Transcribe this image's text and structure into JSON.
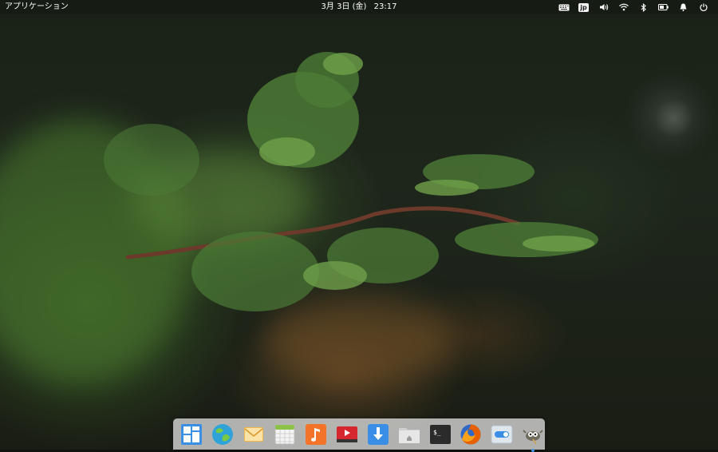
{
  "top_panel": {
    "applications_label": "アプリケーション",
    "clock": {
      "date": "3月 3日 (金)",
      "time": "23:17"
    },
    "indicators": [
      {
        "name": "keyboard-icon"
      },
      {
        "name": "input-method-indicator",
        "label": "jp"
      },
      {
        "name": "volume-icon"
      },
      {
        "name": "wifi-icon"
      },
      {
        "name": "bluetooth-icon"
      },
      {
        "name": "battery-icon"
      },
      {
        "name": "notifications-icon"
      },
      {
        "name": "power-icon"
      }
    ]
  },
  "dock": {
    "items": [
      {
        "name": "multitasking-view-icon",
        "color": "#3a8ee6"
      },
      {
        "name": "web-browser-icon",
        "color": "#2fa3d8"
      },
      {
        "name": "mail-icon",
        "color": "#f3b84a"
      },
      {
        "name": "calendar-icon",
        "color": "#8dc149"
      },
      {
        "name": "music-icon",
        "color": "#f37329"
      },
      {
        "name": "videos-icon",
        "color": "#d6272e"
      },
      {
        "name": "appcenter-icon",
        "color": "#3a8ee6"
      },
      {
        "name": "files-icon",
        "color": "#d0d0d0"
      },
      {
        "name": "terminal-icon",
        "color": "#2b2b2b"
      },
      {
        "name": "firefox-icon",
        "color": "#e66000"
      },
      {
        "name": "system-settings-icon",
        "color": "#dfe6ec"
      },
      {
        "name": "gimp-icon",
        "color": "#6e6a5c",
        "running": true
      }
    ]
  }
}
